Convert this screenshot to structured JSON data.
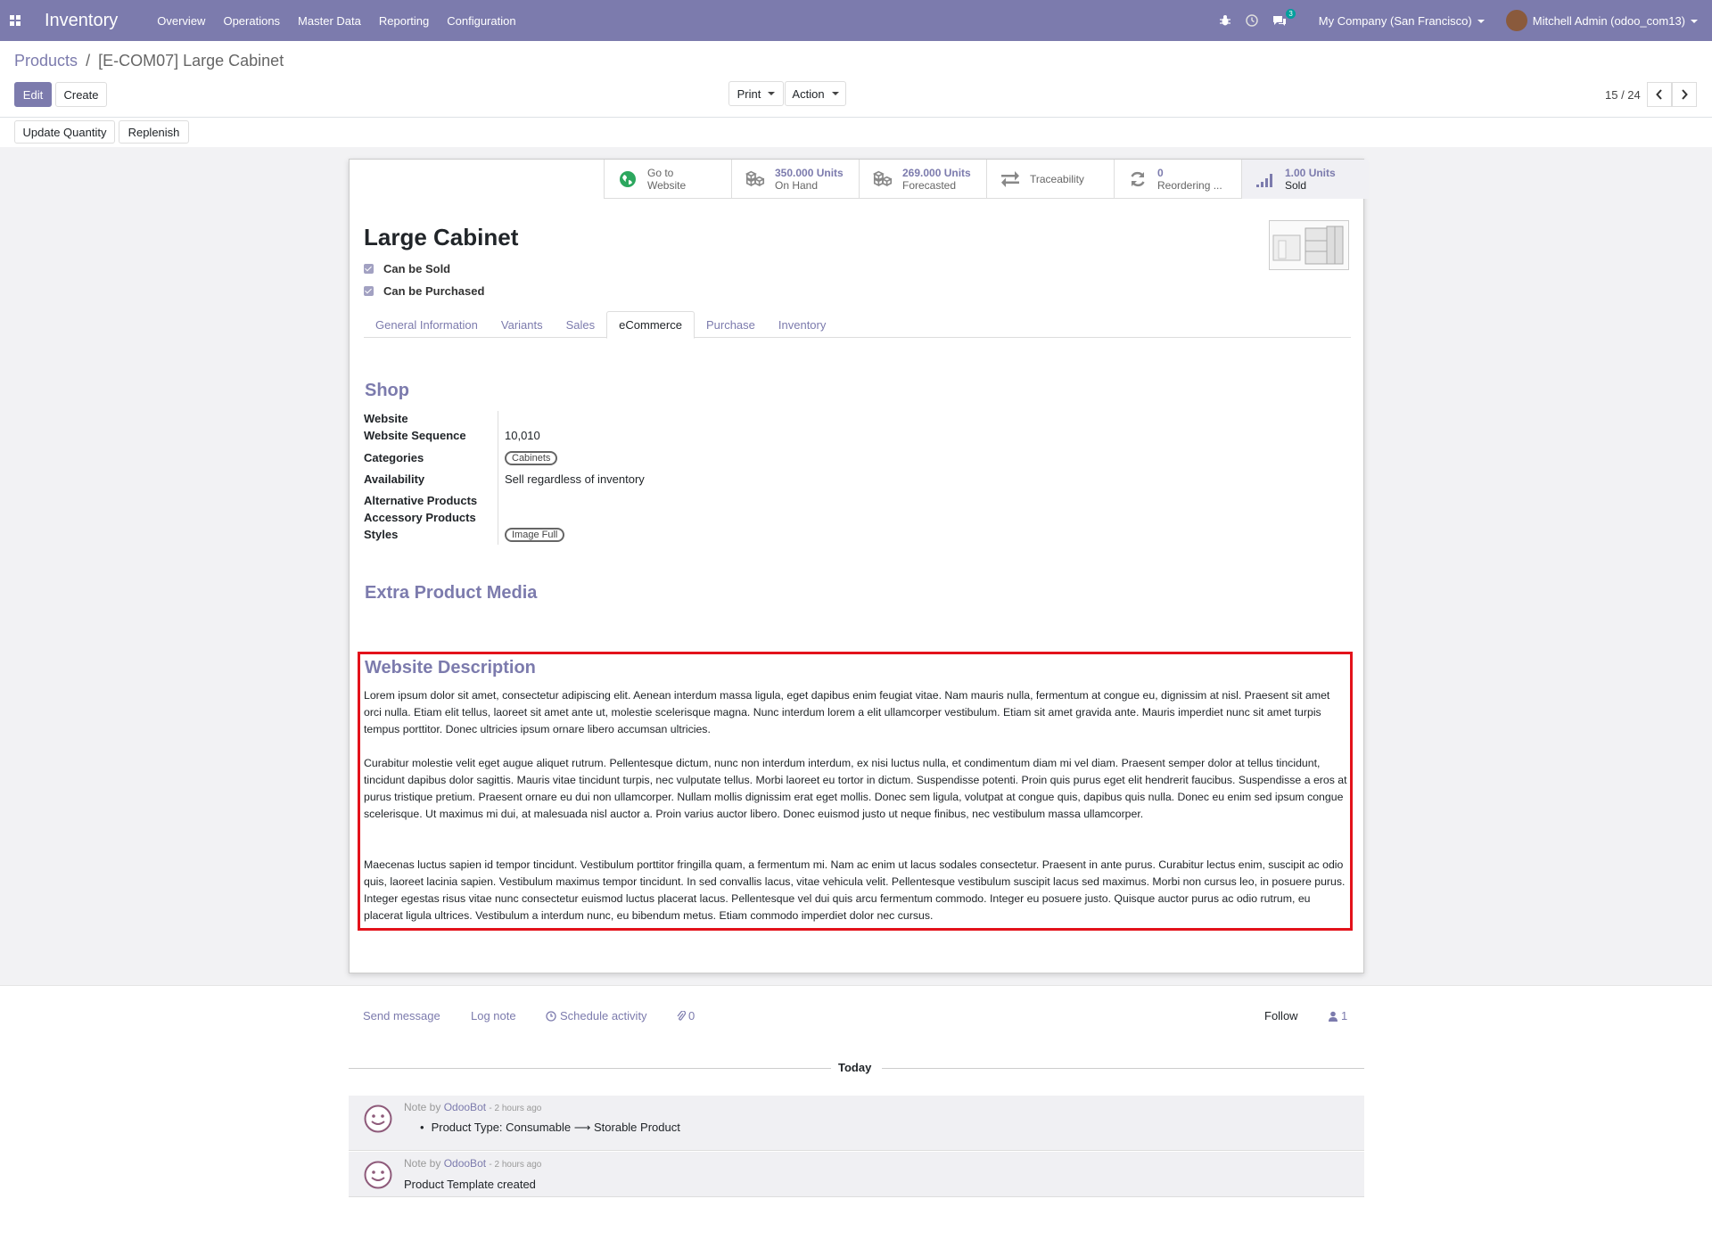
{
  "navbar": {
    "app_name": "Inventory",
    "menu": [
      "Overview",
      "Operations",
      "Master Data",
      "Reporting",
      "Configuration"
    ],
    "messages_count": "3",
    "company": "My Company (San Francisco)",
    "user": "Mitchell Admin (odoo_com13)"
  },
  "breadcrumb": {
    "parent": "Products",
    "separator": "/",
    "current": "[E-COM07] Large Cabinet"
  },
  "toolbar": {
    "edit": "Edit",
    "create": "Create",
    "print": "Print",
    "action": "Action",
    "pager": "15 / 24",
    "update_quantity": "Update Quantity",
    "replenish": "Replenish"
  },
  "stat_buttons": [
    {
      "value": "Go to",
      "label": "Website",
      "icon": "globe-icon"
    },
    {
      "value": "350.000 Units",
      "label": "On Hand",
      "icon": "cubes-icon"
    },
    {
      "value": "269.000 Units",
      "label": "Forecasted",
      "icon": "cubes-icon"
    },
    {
      "value": "",
      "label": "Traceability",
      "icon": "exchange-icon"
    },
    {
      "value": "0",
      "label": "Reordering ...",
      "icon": "refresh-icon"
    },
    {
      "value": "1.00 Units",
      "label": "Sold",
      "icon": "signal-icon"
    }
  ],
  "product": {
    "name": "Large Cabinet",
    "can_be_sold": "Can be Sold",
    "can_be_purchased": "Can be Purchased"
  },
  "tabs": [
    "General Information",
    "Variants",
    "Sales",
    "eCommerce",
    "Purchase",
    "Inventory"
  ],
  "active_tab": "eCommerce",
  "shop": {
    "title": "Shop",
    "fields": {
      "website_label": "Website",
      "sequence_label": "Website Sequence",
      "sequence_value": "10,010",
      "categories_label": "Categories",
      "categories_tag": "Cabinets",
      "availability_label": "Availability",
      "availability_value": "Sell regardless of inventory",
      "alternative_label": "Alternative Products",
      "accessory_label": "Accessory Products",
      "styles_label": "Styles",
      "styles_tag": "Image Full"
    }
  },
  "extra_media_title": "Extra Product Media",
  "website_description": {
    "title": "Website Description",
    "paragraphs": [
      "Lorem ipsum dolor sit amet, consectetur adipiscing elit. Aenean interdum massa ligula, eget dapibus enim feugiat vitae. Nam mauris nulla, fermentum at congue eu, dignissim at nisl. Praesent sit amet orci nulla. Etiam elit tellus, laoreet sit amet ante ut, molestie scelerisque magna. Nunc interdum lorem a elit ullamcorper vestibulum. Etiam sit amet gravida ante. Mauris imperdiet nunc sit amet turpis tempus porttitor. Donec ultricies ipsum ornare libero accumsan ultricies.",
      "Curabitur molestie velit eget augue aliquet rutrum. Pellentesque dictum, nunc non interdum interdum, ex nisi luctus nulla, et condimentum diam mi vel diam. Praesent semper dolor at tellus tincidunt, tincidunt dapibus dolor sagittis. Mauris vitae tincidunt turpis, nec vulputate tellus. Morbi laoreet eu tortor in dictum. Suspendisse potenti. Proin quis purus eget elit hendrerit faucibus. Suspendisse a eros at purus tristique pretium. Praesent ornare eu dui non ullamcorper. Nullam mollis dignissim erat eget mollis. Donec sem ligula, volutpat at congue quis, dapibus quis nulla. Donec eu enim sed ipsum congue scelerisque. Ut maximus mi dui, at malesuada nisl auctor a. Proin varius auctor libero. Donec euismod justo ut neque finibus, nec vestibulum massa ullamcorper.",
      "Maecenas luctus sapien id tempor tincidunt. Vestibulum porttitor fringilla quam, a fermentum mi. Nam ac enim ut lacus sodales consectetur. Praesent in ante purus. Curabitur lectus enim, suscipit ac odio quis, laoreet lacinia sapien. Vestibulum maximus tempor tincidunt. In sed convallis lacus, vitae vehicula velit. Pellentesque vestibulum suscipit lacus sed maximus. Morbi non cursus leo, in posuere purus. Integer egestas risus vitae nunc consectetur euismod luctus placerat lacus. Pellentesque vel dui quis arcu fermentum commodo. Integer eu posuere justo. Quisque auctor purus ac odio rutrum, eu placerat ligula ultrices. Vestibulum a interdum nunc, eu bibendum metus. Etiam commodo imperdiet dolor nec cursus."
    ]
  },
  "chatter": {
    "send_message": "Send message",
    "log_note": "Log note",
    "schedule_activity": "Schedule activity",
    "attachments": "0",
    "follow": "Follow",
    "followers": "1",
    "date_separator": "Today",
    "messages": [
      {
        "prefix": "Note by",
        "author": "OdooBot",
        "ago": "- 2 hours ago",
        "body": "Product Type: Consumable ⟶ Storable Product"
      },
      {
        "prefix": "Note by",
        "author": "OdooBot",
        "ago": "- 2 hours ago",
        "body": "Product Template created"
      }
    ]
  },
  "colors": {
    "brand": "#7c7bad",
    "highlight": "#e3121b",
    "teal": "#00a09d"
  }
}
